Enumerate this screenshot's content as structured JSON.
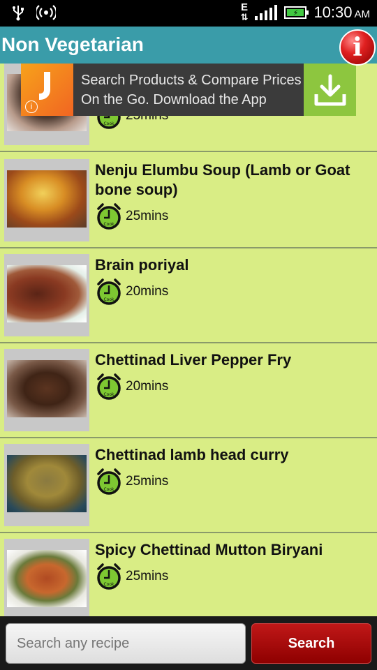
{
  "status_bar": {
    "time": "10:30",
    "ampm": "AM",
    "network": "E",
    "icons": [
      "usb-icon",
      "wifi-hotspot-icon",
      "network-e-icon",
      "signal-icon",
      "battery-charging-icon"
    ]
  },
  "header": {
    "title": "Non Vegetarian",
    "info_icon": "i",
    "color": "#3a9ca9"
  },
  "ad": {
    "line1": "Search Products & Compare Prices",
    "line2": "On the Go. Download the App",
    "info_symbol": "i"
  },
  "recipes": [
    {
      "title": "",
      "cook_time": "25mins"
    },
    {
      "title": "Nenju Elumbu Soup (Lamb or Goat bone soup)",
      "cook_time": "25mins"
    },
    {
      "title": "Brain  poriyal",
      "cook_time": "20mins"
    },
    {
      "title": "Chettinad Liver Pepper Fry",
      "cook_time": "20mins"
    },
    {
      "title": "Chettinad lamb head curry",
      "cook_time": "25mins"
    },
    {
      "title": "Spicy Chettinad Mutton Biryani",
      "cook_time": "25mins"
    }
  ],
  "clock_label": "Cook",
  "search": {
    "placeholder": "Search any recipe",
    "button_label": "Search"
  },
  "colors": {
    "list_bg": "#d9ed85",
    "search_button": "#b01010",
    "ad_download": "#8dc63f"
  }
}
